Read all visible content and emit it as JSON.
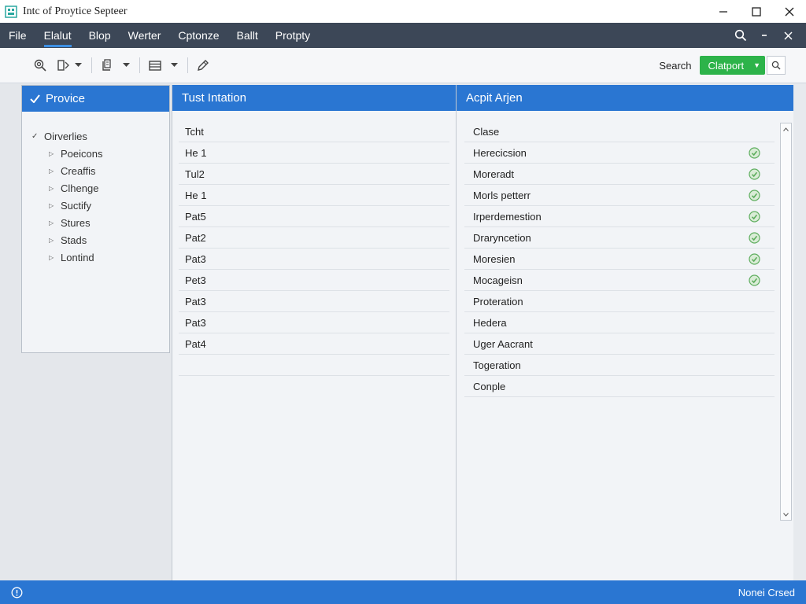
{
  "window": {
    "title": "Intc of Proytice Septeer",
    "icons": [
      "app-icon",
      "minimize-icon",
      "maximize-icon",
      "close-icon"
    ]
  },
  "menubar": {
    "items": [
      "File",
      "Elalut",
      "Blop",
      "Werter",
      "Cptonze",
      "Ballt",
      "Protpty"
    ],
    "active_index": 1,
    "right_icons": [
      "search-icon",
      "minimize-icon",
      "close-icon"
    ]
  },
  "toolbar": {
    "icons": [
      "zoom-icon",
      "panel-icon",
      "document-icon",
      "list-icon",
      "edit-icon"
    ],
    "search_label": "Search",
    "green_button_label": "Clatport",
    "search_button_icon": "search-icon"
  },
  "left_panel": {
    "header": "Provice",
    "tree_root": "Oirverlies",
    "tree_children": [
      "Poeicons",
      "Creaffis",
      "Clhenge",
      "Suctify",
      "Stures",
      "Stads",
      "Lontind"
    ]
  },
  "mid_panel": {
    "header": "Tust Intation",
    "rows": [
      "Tcht",
      "He 1",
      "Tul2",
      "He 1",
      "Pat5",
      "Pat2",
      "Pat3",
      "Pet3",
      "Pat3",
      "Pat3",
      "Pat4",
      ""
    ]
  },
  "right_panel": {
    "header": "Acpit Arjen",
    "rows": [
      {
        "label": "Clase",
        "checked": false
      },
      {
        "label": "Herecicsion",
        "checked": true
      },
      {
        "label": "Moreradt",
        "checked": true
      },
      {
        "label": "Morls petterr",
        "checked": true
      },
      {
        "label": "Irperdemestion",
        "checked": true
      },
      {
        "label": "Draryncetion",
        "checked": true
      },
      {
        "label": "Moresien",
        "checked": true
      },
      {
        "label": "Mocageisn",
        "checked": true
      },
      {
        "label": "Proteration",
        "checked": false
      },
      {
        "label": "Hedera",
        "checked": false
      },
      {
        "label": "Uger Aacrant",
        "checked": false
      },
      {
        "label": "Togeration",
        "checked": false
      },
      {
        "label": "Conple",
        "checked": false
      }
    ]
  },
  "statusbar": {
    "icon": "info-icon",
    "text": "Nonei Crsed"
  },
  "colors": {
    "menubar": "#3c4757",
    "accent_blue": "#2a76d2",
    "green_button": "#2db34a",
    "check_green": "#5fae5f"
  }
}
